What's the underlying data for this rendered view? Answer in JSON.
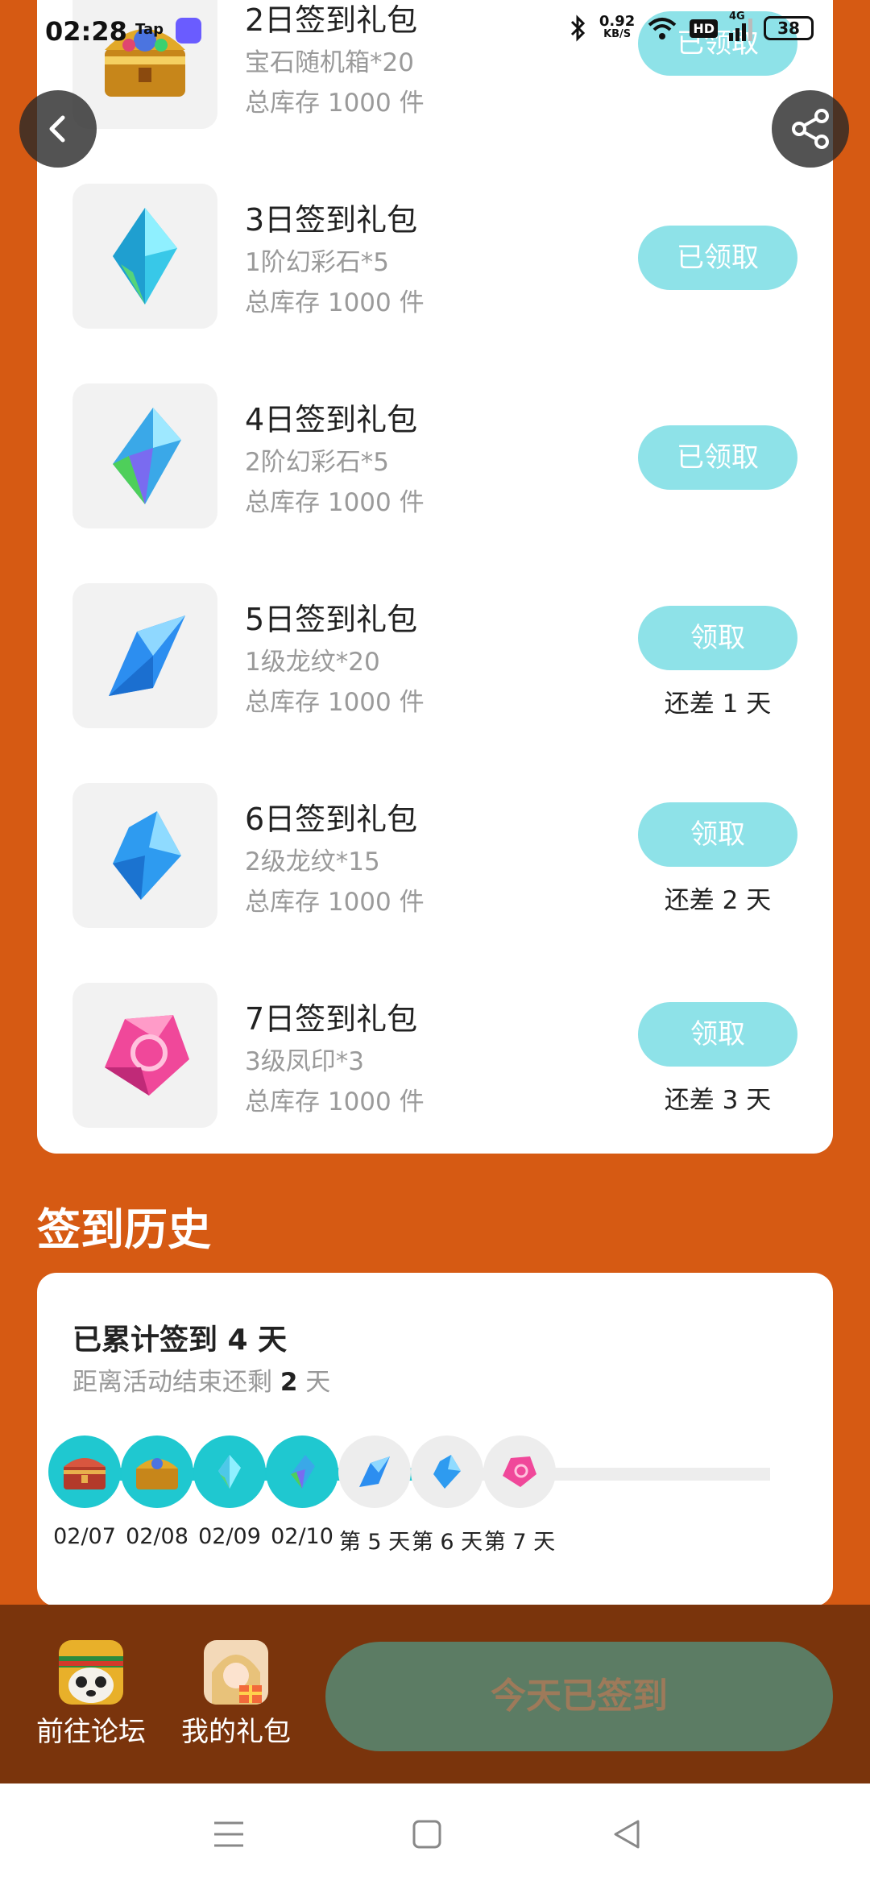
{
  "status_bar": {
    "time": "02:28",
    "tap_label": "Tap",
    "speed_value": "0.92",
    "speed_unit": "KB/S",
    "hd": "HD",
    "network": "4G",
    "battery": "38",
    "icons": [
      "bluetooth-icon",
      "wifi-icon",
      "signal-icon"
    ]
  },
  "toolbar": {
    "back_icon": "chevron-left-icon",
    "share_icon": "share-icon"
  },
  "gifts": [
    {
      "title": "2日签到礼包",
      "desc": "宝石随机箱*20",
      "stock": "总库存 1000 件",
      "button": "已领取",
      "days_left": "",
      "icon": "treasure-chest-icon"
    },
    {
      "title": "3日签到礼包",
      "desc": "1阶幻彩石*5",
      "stock": "总库存 1000 件",
      "button": "已领取",
      "days_left": "",
      "icon": "blue-crystal-icon"
    },
    {
      "title": "4日签到礼包",
      "desc": "2阶幻彩石*5",
      "stock": "总库存 1000 件",
      "button": "已领取",
      "days_left": "",
      "icon": "rainbow-crystal-icon"
    },
    {
      "title": "5日签到礼包",
      "desc": "1级龙纹*20",
      "stock": "总库存 1000 件",
      "button": "领取",
      "days_left": "还差 1 天",
      "icon": "blue-shard-icon"
    },
    {
      "title": "6日签到礼包",
      "desc": "2级龙纹*15",
      "stock": "总库存 1000 件",
      "button": "领取",
      "days_left": "还差 2 天",
      "icon": "blue-gem-icon"
    },
    {
      "title": "7日签到礼包",
      "desc": "3级凤印*3",
      "stock": "总库存 1000 件",
      "button": "领取",
      "days_left": "还差 3 天",
      "icon": "pink-gem-icon"
    }
  ],
  "history": {
    "title": "签到历史",
    "cumulative_prefix": "已累计签到 ",
    "cumulative_days": "4",
    "cumulative_suffix": " 天",
    "remaining_prefix": "距离活动结束还剩 ",
    "remaining_days": "2",
    "remaining_suffix": " 天",
    "progress_fraction": 0.57,
    "timeline": [
      {
        "label": "02/07",
        "done": true,
        "icon": "red-chest-icon"
      },
      {
        "label": "02/08",
        "done": true,
        "icon": "treasure-chest-icon"
      },
      {
        "label": "02/09",
        "done": true,
        "icon": "blue-crystal-icon"
      },
      {
        "label": "02/10",
        "done": true,
        "icon": "rainbow-crystal-icon"
      },
      {
        "label": "第 5 天",
        "done": false,
        "icon": "blue-shard-icon"
      },
      {
        "label": "第 6 天",
        "done": false,
        "icon": "blue-gem-icon"
      },
      {
        "label": "第 7 天",
        "done": false,
        "icon": "pink-gem-icon"
      }
    ]
  },
  "bottom_bar": {
    "forum_label": "前往论坛",
    "my_gifts_label": "我的礼包",
    "signed_label": "今天已签到"
  },
  "nav": {
    "icons": [
      "menu-icon",
      "home-icon",
      "back-triangle-icon"
    ]
  },
  "colors": {
    "background": "#D65A13",
    "accent_cyan": "#1FC8D0",
    "claim_button": "#8EE2E8",
    "bottom_bar": "#7A340C",
    "signed_button": "#5C7C64"
  }
}
